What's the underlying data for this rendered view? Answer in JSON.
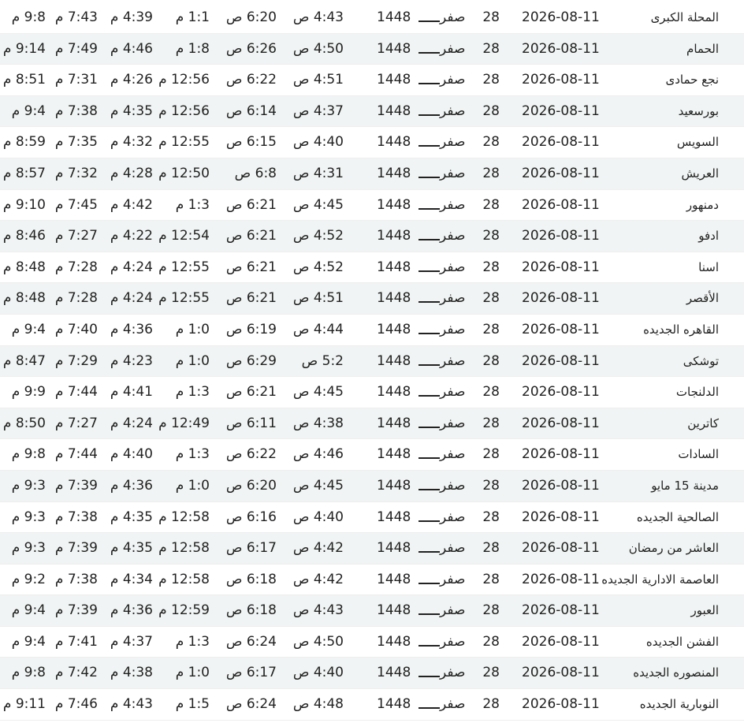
{
  "rows": [
    {
      "city": "المحلة الكبرى",
      "gregorian": "2026-08-11",
      "hijri_day": "28",
      "hijri_month": "صفر",
      "hijri_year": "1448",
      "fajr": "4:43 ص",
      "sunrise": "6:20 ص",
      "dhuhr": "1:1 م",
      "asr": "4:39 م",
      "maghrib": "7:43 م",
      "isha": "9:8 م"
    },
    {
      "city": "الحمام",
      "gregorian": "2026-08-11",
      "hijri_day": "28",
      "hijri_month": "صفر",
      "hijri_year": "1448",
      "fajr": "4:50 ص",
      "sunrise": "6:26 ص",
      "dhuhr": "1:8 م",
      "asr": "4:46 م",
      "maghrib": "7:49 م",
      "isha": "9:14 م"
    },
    {
      "city": "نجع حمادى",
      "gregorian": "2026-08-11",
      "hijri_day": "28",
      "hijri_month": "صفر",
      "hijri_year": "1448",
      "fajr": "4:51 ص",
      "sunrise": "6:22 ص",
      "dhuhr": "12:56 م",
      "asr": "4:26 م",
      "maghrib": "7:31 م",
      "isha": "8:51 م"
    },
    {
      "city": "بورسعيد",
      "gregorian": "2026-08-11",
      "hijri_day": "28",
      "hijri_month": "صفر",
      "hijri_year": "1448",
      "fajr": "4:37 ص",
      "sunrise": "6:14 ص",
      "dhuhr": "12:56 م",
      "asr": "4:35 م",
      "maghrib": "7:38 م",
      "isha": "9:4 م"
    },
    {
      "city": "السويس",
      "gregorian": "2026-08-11",
      "hijri_day": "28",
      "hijri_month": "صفر",
      "hijri_year": "1448",
      "fajr": "4:40 ص",
      "sunrise": "6:15 ص",
      "dhuhr": "12:55 م",
      "asr": "4:32 م",
      "maghrib": "7:35 م",
      "isha": "8:59 م"
    },
    {
      "city": "العريش",
      "gregorian": "2026-08-11",
      "hijri_day": "28",
      "hijri_month": "صفر",
      "hijri_year": "1448",
      "fajr": "4:31 ص",
      "sunrise": "6:8 ص",
      "dhuhr": "12:50 م",
      "asr": "4:28 م",
      "maghrib": "7:32 م",
      "isha": "8:57 م"
    },
    {
      "city": "دمنهور",
      "gregorian": "2026-08-11",
      "hijri_day": "28",
      "hijri_month": "صفر",
      "hijri_year": "1448",
      "fajr": "4:45 ص",
      "sunrise": "6:21 ص",
      "dhuhr": "1:3 م",
      "asr": "4:42 م",
      "maghrib": "7:45 م",
      "isha": "9:10 م"
    },
    {
      "city": "ادفو",
      "gregorian": "2026-08-11",
      "hijri_day": "28",
      "hijri_month": "صفر",
      "hijri_year": "1448",
      "fajr": "4:52 ص",
      "sunrise": "6:21 ص",
      "dhuhr": "12:54 م",
      "asr": "4:22 م",
      "maghrib": "7:27 م",
      "isha": "8:46 م"
    },
    {
      "city": "اسنا",
      "gregorian": "2026-08-11",
      "hijri_day": "28",
      "hijri_month": "صفر",
      "hijri_year": "1448",
      "fajr": "4:52 ص",
      "sunrise": "6:21 ص",
      "dhuhr": "12:55 م",
      "asr": "4:24 م",
      "maghrib": "7:28 م",
      "isha": "8:48 م"
    },
    {
      "city": "الأقصر",
      "gregorian": "2026-08-11",
      "hijri_day": "28",
      "hijri_month": "صفر",
      "hijri_year": "1448",
      "fajr": "4:51 ص",
      "sunrise": "6:21 ص",
      "dhuhr": "12:55 م",
      "asr": "4:24 م",
      "maghrib": "7:28 م",
      "isha": "8:48 م"
    },
    {
      "city": "القاهره الجديده",
      "gregorian": "2026-08-11",
      "hijri_day": "28",
      "hijri_month": "صفر",
      "hijri_year": "1448",
      "fajr": "4:44 ص",
      "sunrise": "6:19 ص",
      "dhuhr": "1:0 م",
      "asr": "4:36 م",
      "maghrib": "7:40 م",
      "isha": "9:4 م"
    },
    {
      "city": "توشكى",
      "gregorian": "2026-08-11",
      "hijri_day": "28",
      "hijri_month": "صفر",
      "hijri_year": "1448",
      "fajr": "5:2 ص",
      "sunrise": "6:29 ص",
      "dhuhr": "1:0 م",
      "asr": "4:23 م",
      "maghrib": "7:29 م",
      "isha": "8:47 م"
    },
    {
      "city": "الدلنجات",
      "gregorian": "2026-08-11",
      "hijri_day": "28",
      "hijri_month": "صفر",
      "hijri_year": "1448",
      "fajr": "4:45 ص",
      "sunrise": "6:21 ص",
      "dhuhr": "1:3 م",
      "asr": "4:41 م",
      "maghrib": "7:44 م",
      "isha": "9:9 م"
    },
    {
      "city": "كاترين",
      "gregorian": "2026-08-11",
      "hijri_day": "28",
      "hijri_month": "صفر",
      "hijri_year": "1448",
      "fajr": "4:38 ص",
      "sunrise": "6:11 ص",
      "dhuhr": "12:49 م",
      "asr": "4:24 م",
      "maghrib": "7:27 م",
      "isha": "8:50 م"
    },
    {
      "city": "السادات",
      "gregorian": "2026-08-11",
      "hijri_day": "28",
      "hijri_month": "صفر",
      "hijri_year": "1448",
      "fajr": "4:46 ص",
      "sunrise": "6:22 ص",
      "dhuhr": "1:3 م",
      "asr": "4:40 م",
      "maghrib": "7:44 م",
      "isha": "9:8 م"
    },
    {
      "city": "مدينة 15 مايو",
      "gregorian": "2026-08-11",
      "hijri_day": "28",
      "hijri_month": "صفر",
      "hijri_year": "1448",
      "fajr": "4:45 ص",
      "sunrise": "6:20 ص",
      "dhuhr": "1:0 م",
      "asr": "4:36 م",
      "maghrib": "7:39 م",
      "isha": "9:3 م"
    },
    {
      "city": "الصالحية الجديده",
      "gregorian": "2026-08-11",
      "hijri_day": "28",
      "hijri_month": "صفر",
      "hijri_year": "1448",
      "fajr": "4:40 ص",
      "sunrise": "6:16 ص",
      "dhuhr": "12:58 م",
      "asr": "4:35 م",
      "maghrib": "7:38 م",
      "isha": "9:3 م"
    },
    {
      "city": "العاشر من رمضان",
      "gregorian": "2026-08-11",
      "hijri_day": "28",
      "hijri_month": "صفر",
      "hijri_year": "1448",
      "fajr": "4:42 ص",
      "sunrise": "6:17 ص",
      "dhuhr": "12:58 م",
      "asr": "4:35 م",
      "maghrib": "7:39 م",
      "isha": "9:3 م"
    },
    {
      "city": "العاصمة الادارية الجديده",
      "gregorian": "2026-08-11",
      "hijri_day": "28",
      "hijri_month": "صفر",
      "hijri_year": "1448",
      "fajr": "4:42 ص",
      "sunrise": "6:18 ص",
      "dhuhr": "12:58 م",
      "asr": "4:34 م",
      "maghrib": "7:38 م",
      "isha": "9:2 م"
    },
    {
      "city": "العبور",
      "gregorian": "2026-08-11",
      "hijri_day": "28",
      "hijri_month": "صفر",
      "hijri_year": "1448",
      "fajr": "4:43 ص",
      "sunrise": "6:18 ص",
      "dhuhr": "12:59 م",
      "asr": "4:36 م",
      "maghrib": "7:39 م",
      "isha": "9:4 م"
    },
    {
      "city": "الفشن الجديده",
      "gregorian": "2026-08-11",
      "hijri_day": "28",
      "hijri_month": "صفر",
      "hijri_year": "1448",
      "fajr": "4:50 ص",
      "sunrise": "6:24 ص",
      "dhuhr": "1:3 م",
      "asr": "4:37 م",
      "maghrib": "7:41 م",
      "isha": "9:4 م"
    },
    {
      "city": "المنصوره الجديده",
      "gregorian": "2026-08-11",
      "hijri_day": "28",
      "hijri_month": "صفر",
      "hijri_year": "1448",
      "fajr": "4:40 ص",
      "sunrise": "6:17 ص",
      "dhuhr": "1:0 م",
      "asr": "4:38 م",
      "maghrib": "7:42 م",
      "isha": "9:8 م"
    },
    {
      "city": "النوبارية الجديده",
      "gregorian": "2026-08-11",
      "hijri_day": "28",
      "hijri_month": "صفر",
      "hijri_year": "1448",
      "fajr": "4:48 ص",
      "sunrise": "6:24 ص",
      "dhuhr": "1:5 م",
      "asr": "4:43 م",
      "maghrib": "7:46 م",
      "isha": "9:11 م"
    }
  ]
}
